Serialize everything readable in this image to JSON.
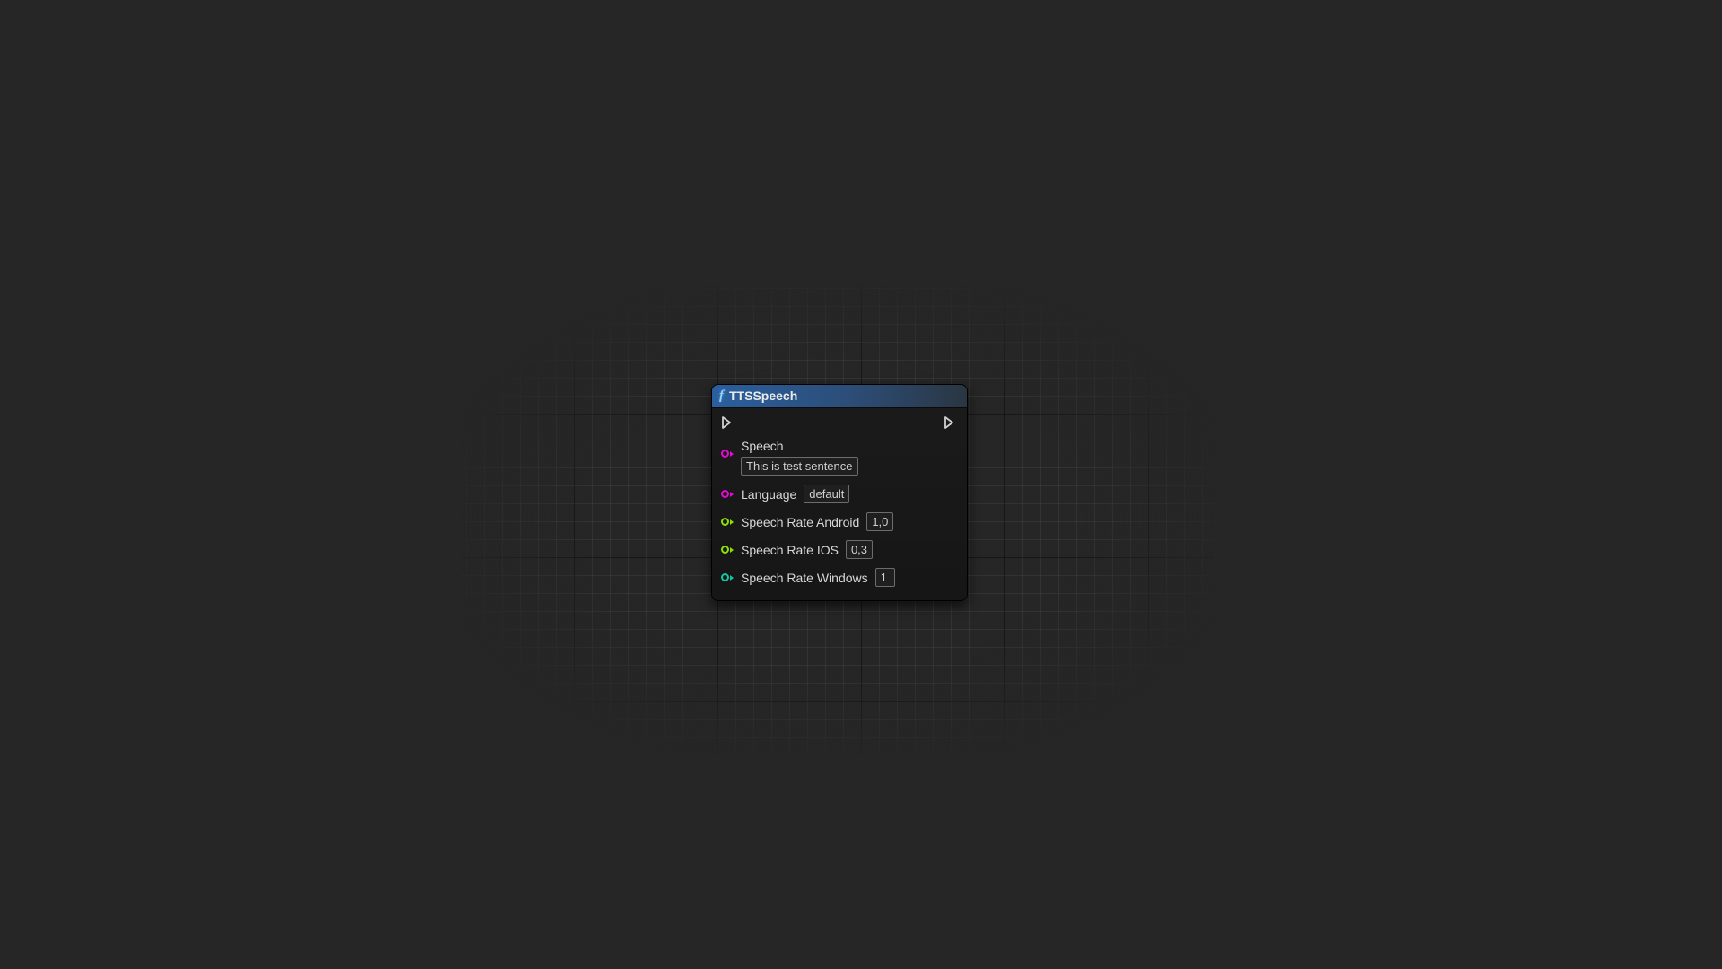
{
  "node": {
    "title": "TTSSpeech",
    "pins": {
      "speech": {
        "label": "Speech",
        "value": "This is test sentence"
      },
      "language": {
        "label": "Language",
        "value": "default"
      },
      "rate_android": {
        "label": "Speech Rate Android",
        "value": "1,0"
      },
      "rate_ios": {
        "label": "Speech Rate IOS",
        "value": "0,3"
      },
      "rate_windows": {
        "label": "Speech Rate Windows",
        "value": "1"
      }
    }
  }
}
